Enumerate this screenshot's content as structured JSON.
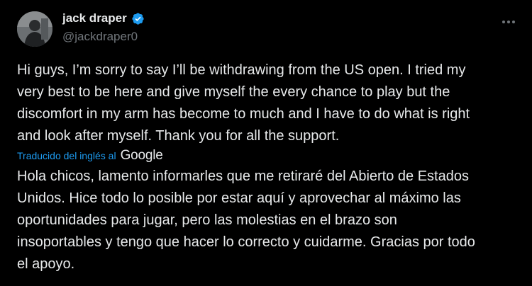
{
  "author": {
    "display_name": "jack draper",
    "handle": "@jackdraper0",
    "verified": true,
    "avatar_icon": "avatar-photo"
  },
  "tweet": {
    "text": "Hi guys, I’m sorry to say I’ll be withdrawing from the US open. I tried my\nvery best to be here and give myself the every chance to play but the\ndiscomfort in my arm has become to much and I have to do what is right\nand look after myself. Thank you for all the support.",
    "translation_label": "Traducido del inglés al",
    "translation_provider": "Google",
    "translated_text": "Hola chicos, lamento informarles que me retiraré del Abierto de Estados\nUnidos. Hice todo lo posible por estar aquí y aprovechar al máximo las\noportunidades para jugar, pero las molestias en el brazo son\ninsoportables y tengo que hacer lo correcto y cuidarme. Gracias por todo\nel apoyo."
  },
  "colors": {
    "background": "#000000",
    "text": "#e7e9ea",
    "secondary_text": "#71767b",
    "link": "#1d9bf0",
    "verified_badge": "#1d9bf0"
  },
  "icons": {
    "verified": "verified-badge-icon",
    "more": "more-options-icon"
  }
}
